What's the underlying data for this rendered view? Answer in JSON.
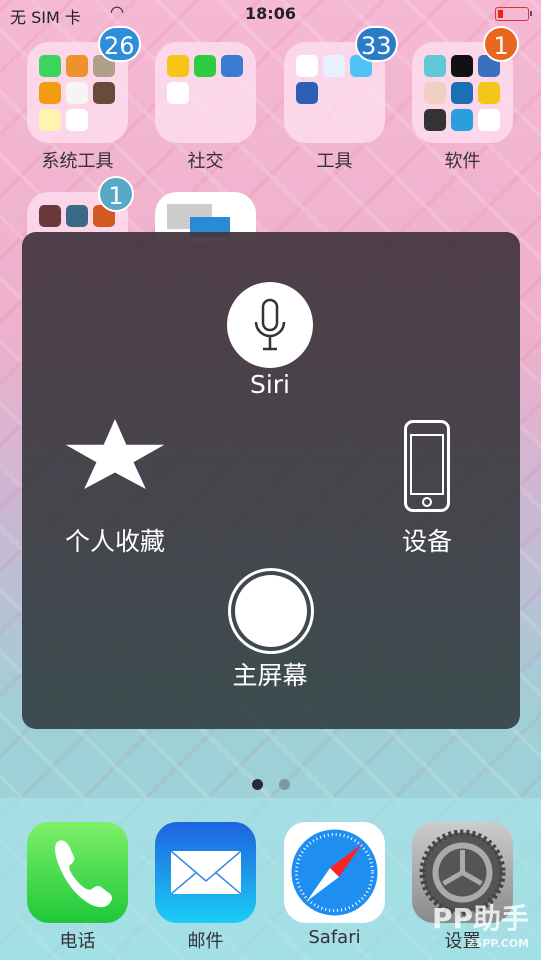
{
  "status": {
    "carrier": "无 SIM 卡",
    "time": "18:06",
    "battery_level": 0.15
  },
  "folders": [
    {
      "label": "系统工具",
      "badge": "26",
      "badge_color": "#2d8fdc",
      "apps": [
        "#3dd45a",
        "#f0922c",
        "#b0a08a",
        "#f39c12",
        "#f5f5f5",
        "#6a4a3a",
        "#fff3b0",
        "#ffffff"
      ]
    },
    {
      "label": "社交",
      "badge": "",
      "apps": [
        "#f5c518",
        "#2ecc40",
        "#3a7bd5",
        "#ffffff"
      ]
    },
    {
      "label": "工具",
      "badge": "33",
      "badge_color": "#2a7cc7",
      "apps": [
        "#ffffff",
        "#e8f0ff",
        "#4fc3f7",
        "#2b5fb5"
      ]
    },
    {
      "label": "软件",
      "badge": "1",
      "badge_color": "#e8661e",
      "apps": [
        "#5ec8d8",
        "#111111",
        "#3a6fc0",
        "#f0d0c0",
        "#1b6fb5",
        "#f5c518",
        "#333333",
        "#2a9fe0",
        "#ffffff"
      ]
    },
    {
      "label": "",
      "badge": "1",
      "badge_color": "#5aa8c8",
      "apps": [
        "#6a3a3a",
        "#3a6a8a",
        "#d05a20"
      ]
    }
  ],
  "assistive_touch": {
    "siri": "Siri",
    "favorites": "个人收藏",
    "device": "设备",
    "home": "主屏幕"
  },
  "page_indicator": {
    "current": 1,
    "total": 2
  },
  "dock": [
    {
      "label": "电话",
      "icon": "phone-icon"
    },
    {
      "label": "邮件",
      "icon": "mail-icon"
    },
    {
      "label": "Safari",
      "icon": "safari-icon"
    },
    {
      "label": "设置",
      "icon": "settings-icon"
    }
  ],
  "watermark": {
    "text": "PP助手",
    "sub": "25PP.COM"
  }
}
